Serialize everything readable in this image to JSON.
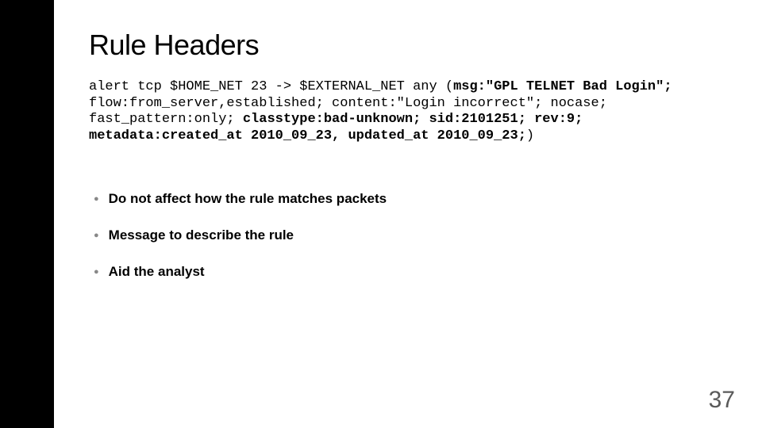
{
  "title": "Rule Headers",
  "code": {
    "part1": "alert tcp $HOME_NET 23 -> $EXTERNAL_NET any (",
    "bold1": "msg:\"GPL TELNET Bad Login\"; ",
    "part2": "flow:from_server,established; content:\"Login incorrect\"; nocase; fast_pattern:only; ",
    "bold2": "classtype:bad-unknown; sid:2101251; rev:9; metadata:created_at 2010_09_23, updated_at 2010_09_23;",
    "part3": ")"
  },
  "bullets": [
    "Do not affect how the rule matches packets",
    "Message to describe the rule",
    "Aid the analyst"
  ],
  "page_number": "37"
}
